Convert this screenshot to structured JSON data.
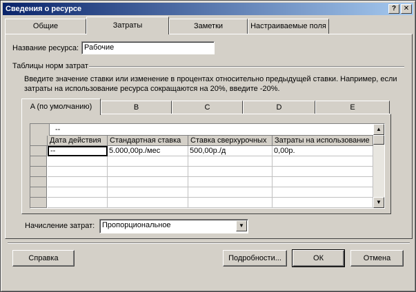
{
  "window": {
    "title": "Сведения о ресурсе",
    "help_glyph": "?",
    "close_glyph": "✕"
  },
  "tabs": [
    {
      "label": "Общие",
      "active": false
    },
    {
      "label": "Затраты",
      "active": true
    },
    {
      "label": "Заметки",
      "active": false
    },
    {
      "label": "Настраиваемые поля",
      "active": false
    }
  ],
  "resource": {
    "name_label": "Название ресурса:",
    "name_value": "Рабочие"
  },
  "rates_group": {
    "label": "Таблицы норм затрат",
    "hint_line1": "Введите значение ставки или изменение в процентах относительно предыдущей ставки. Например, если",
    "hint_line2": "затраты на использование ресурса сокращаются на 20%, введите -20%."
  },
  "rate_tabs": [
    {
      "label": "A (по умолчанию)",
      "active": true
    },
    {
      "label": "B",
      "active": false
    },
    {
      "label": "C",
      "active": false
    },
    {
      "label": "D",
      "active": false
    },
    {
      "label": "E",
      "active": false
    }
  ],
  "grid": {
    "edit_value": "--",
    "columns": [
      "Дата действия",
      "Стандартная ставка",
      "Ставка сверхурочных",
      "Затраты на использование"
    ],
    "rows": [
      [
        "--",
        "5.000,00р./мес",
        "500,00р./д",
        "0,00р."
      ],
      [
        "",
        "",
        "",
        ""
      ],
      [
        "",
        "",
        "",
        ""
      ],
      [
        "",
        "",
        "",
        ""
      ],
      [
        "",
        "",
        "",
        ""
      ],
      [
        "",
        "",
        "",
        ""
      ]
    ]
  },
  "accrual": {
    "label": "Начисление затрат:",
    "value": "Пропорциональное"
  },
  "buttons": {
    "help": "Справка",
    "details": "Подробности...",
    "ok": "ОК",
    "cancel": "Отмена"
  }
}
